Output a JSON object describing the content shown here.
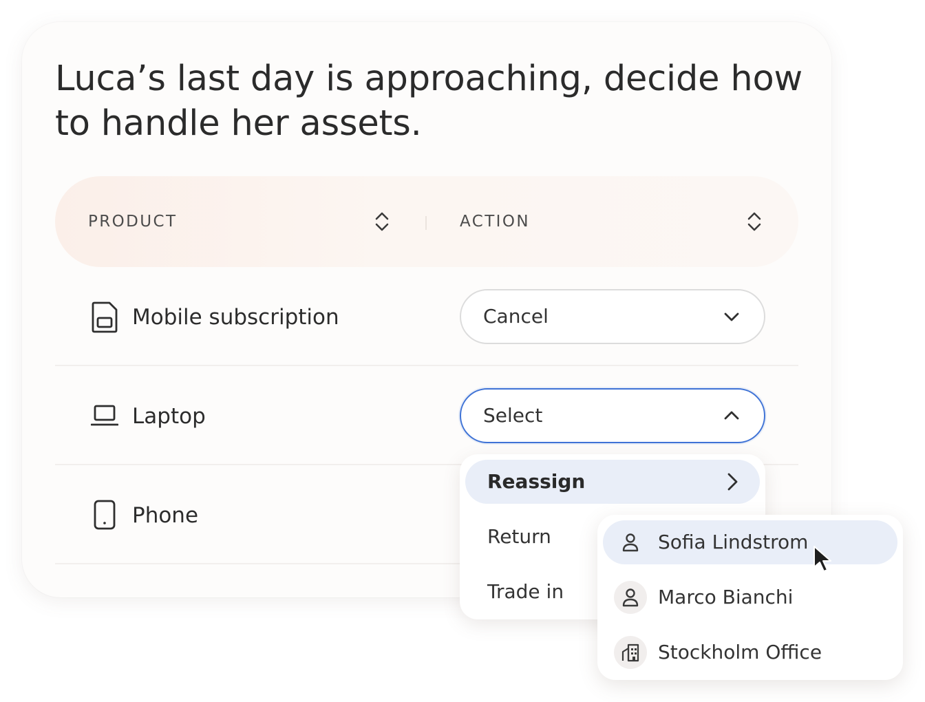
{
  "title": "Luca’s last day is approaching, decide how to handle her assets.",
  "table": {
    "columns": [
      "PRODUCT",
      "ACTION"
    ],
    "rows": [
      {
        "icon": "sim-card-icon",
        "product": "Mobile subscription",
        "action": "Cancel",
        "open": false
      },
      {
        "icon": "laptop-icon",
        "product": "Laptop",
        "action": "Select",
        "open": true
      },
      {
        "icon": "phone-icon",
        "product": "Phone",
        "action": "",
        "open": false
      }
    ]
  },
  "action_menu": {
    "items": [
      "Reassign",
      "Return",
      "Trade in"
    ],
    "active": "Reassign"
  },
  "reassign_menu": {
    "items": [
      {
        "icon": "person-icon",
        "label": "Sofia Lindstrom"
      },
      {
        "icon": "person-icon",
        "label": "Marco Bianchi"
      },
      {
        "icon": "building-icon",
        "label": "Stockholm Office"
      }
    ],
    "hovered": "Sofia Lindstrom"
  },
  "colors": {
    "accent": "#3f73d6",
    "highlight": "#e9eef8",
    "header_bg": "#fbefe9"
  }
}
